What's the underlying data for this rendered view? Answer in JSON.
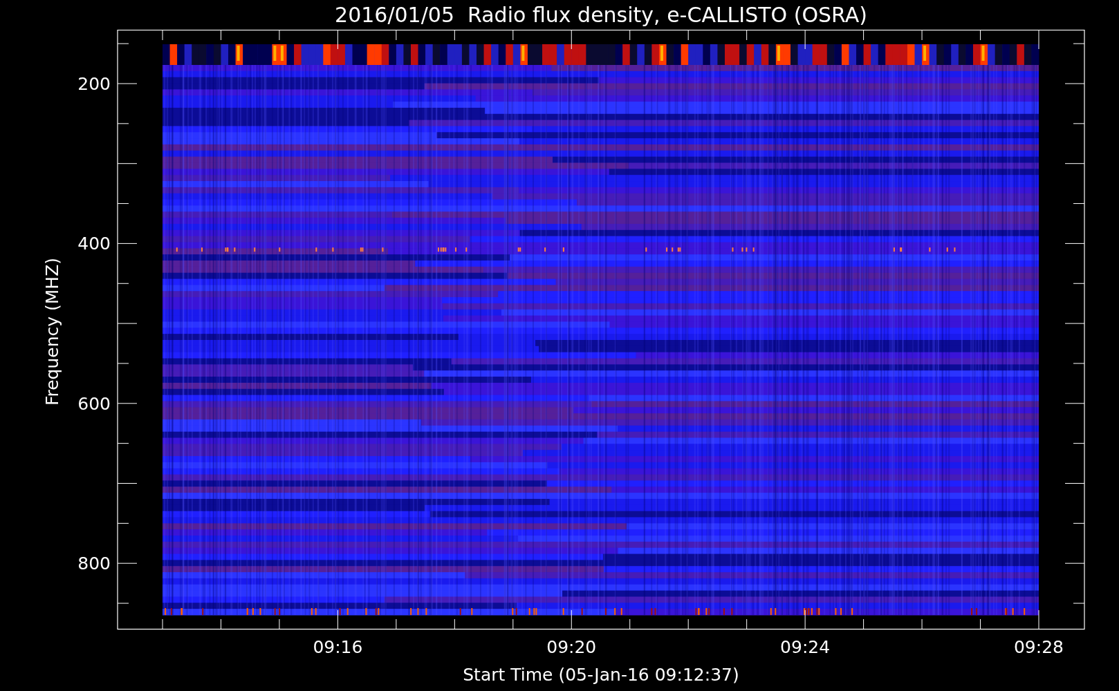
{
  "title": "2016/01/05  Radio flux density, e-CALLISTO (OSRA)",
  "plot": {
    "ylabel": "Frequency (MHZ)",
    "xlabel": "Start Time (05-Jan-16 09:12:37)",
    "yticks": [
      "200",
      "400",
      "600",
      "800"
    ],
    "xticks": [
      "09:16",
      "09:20",
      "09:24",
      "09:28"
    ]
  }
}
